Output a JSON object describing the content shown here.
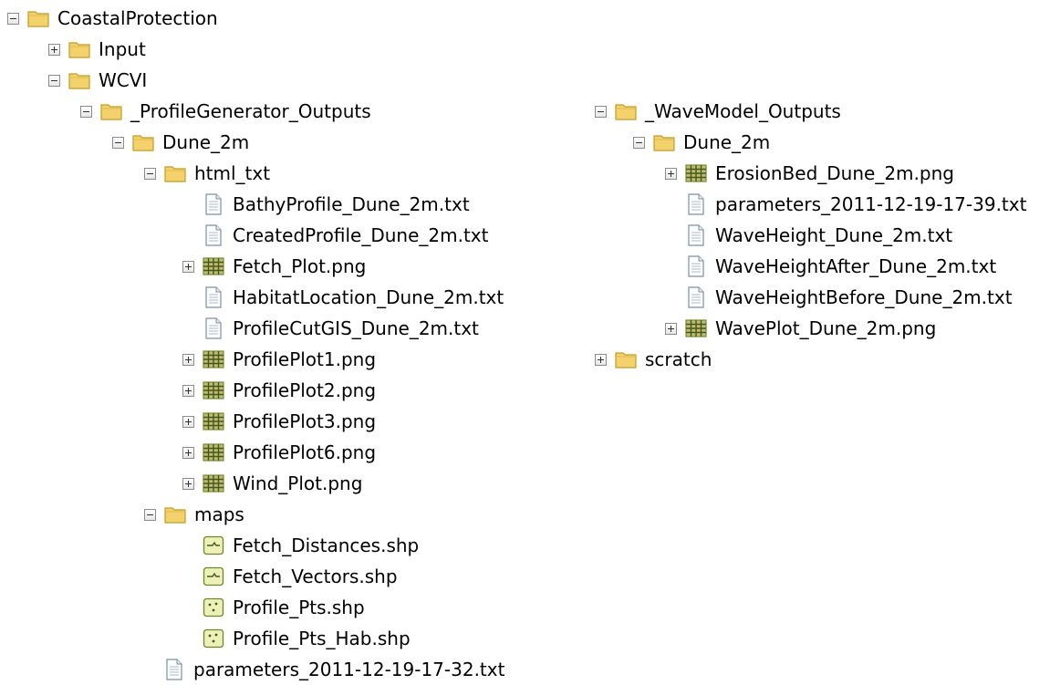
{
  "tree_left": {
    "root": {
      "label": "CoastalProtection",
      "icon": "folder-icon"
    },
    "input": {
      "label": "Input",
      "icon": "folder-icon"
    },
    "wcvi": {
      "label": "WCVI",
      "icon": "folder-icon"
    },
    "profile_generator_outputs": {
      "label": "_ProfileGenerator_Outputs",
      "icon": "folder-icon"
    },
    "dune_2m": {
      "label": "Dune_2m",
      "icon": "folder-icon"
    },
    "html_txt": {
      "label": "html_txt",
      "icon": "folder-icon"
    },
    "files_html_txt": [
      {
        "label": "BathyProfile_Dune_2m.txt",
        "icon": "text-file-icon"
      },
      {
        "label": "CreatedProfile_Dune_2m.txt",
        "icon": "text-file-icon"
      },
      {
        "label": "Fetch_Plot.png",
        "icon": "raster-icon"
      },
      {
        "label": "HabitatLocation_Dune_2m.txt",
        "icon": "text-file-icon"
      },
      {
        "label": "ProfileCutGIS_Dune_2m.txt",
        "icon": "text-file-icon"
      },
      {
        "label": "ProfilePlot1.png",
        "icon": "raster-icon"
      },
      {
        "label": "ProfilePlot2.png",
        "icon": "raster-icon"
      },
      {
        "label": "ProfilePlot3.png",
        "icon": "raster-icon"
      },
      {
        "label": "ProfilePlot6.png",
        "icon": "raster-icon"
      },
      {
        "label": "Wind_Plot.png",
        "icon": "raster-icon"
      }
    ],
    "maps": {
      "label": "maps",
      "icon": "folder-icon"
    },
    "files_maps": [
      {
        "label": "Fetch_Distances.shp",
        "icon": "line-shapefile-icon"
      },
      {
        "label": "Fetch_Vectors.shp",
        "icon": "line-shapefile-icon"
      },
      {
        "label": "Profile_Pts.shp",
        "icon": "point-shapefile-icon"
      },
      {
        "label": "Profile_Pts_Hab.shp",
        "icon": "point-shapefile-icon"
      }
    ],
    "parameters_file": {
      "label": "parameters_2011-12-19-17-32.txt",
      "icon": "text-file-icon"
    }
  },
  "tree_right": {
    "wave_model_outputs": {
      "label": "_WaveModel_Outputs",
      "icon": "folder-icon"
    },
    "dune_2m": {
      "label": "Dune_2m",
      "icon": "folder-icon"
    },
    "files": [
      {
        "label": "ErosionBed_Dune_2m.png",
        "icon": "raster-icon"
      },
      {
        "label": "parameters_2011-12-19-17-39.txt",
        "icon": "text-file-icon"
      },
      {
        "label": "WaveHeight_Dune_2m.txt",
        "icon": "text-file-icon"
      },
      {
        "label": "WaveHeightAfter_Dune_2m.txt",
        "icon": "text-file-icon"
      },
      {
        "label": "WaveHeightBefore_Dune_2m.txt",
        "icon": "text-file-icon"
      },
      {
        "label": "WavePlot_Dune_2m.png",
        "icon": "raster-icon"
      }
    ],
    "scratch": {
      "label": "scratch",
      "icon": "folder-icon"
    }
  },
  "colors": {
    "folder_fill": "#f3d26b",
    "folder_border": "#c49b23",
    "raster_green": "#6f8f2f",
    "shapefile_fill": "#eef0b8",
    "shapefile_border": "#6a8a2a"
  }
}
